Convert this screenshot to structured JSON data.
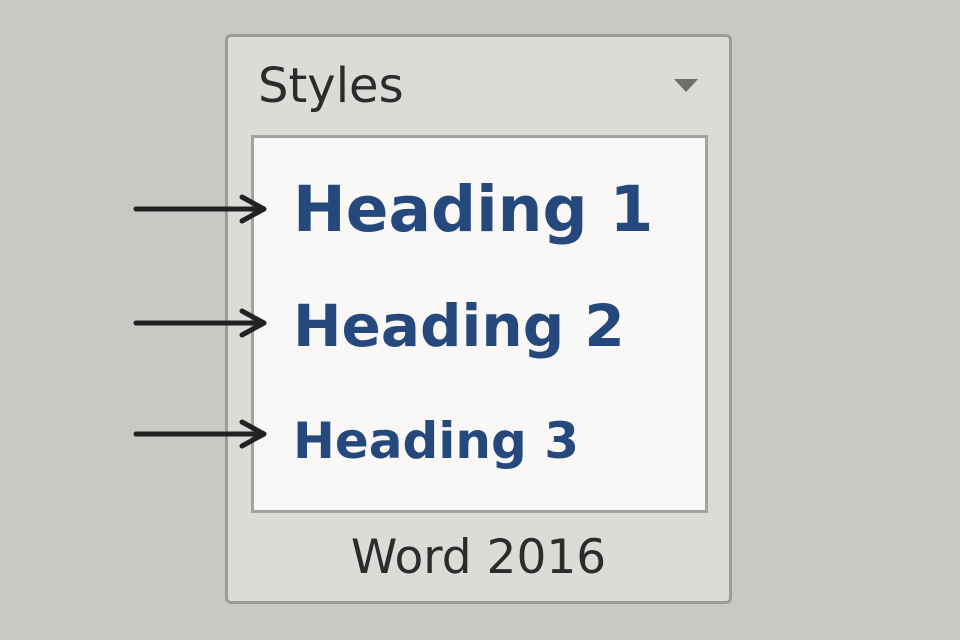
{
  "panel": {
    "title": "Styles",
    "dropdown_icon": "chevron-down-icon",
    "footer": "Word 2016"
  },
  "gallery": {
    "items": [
      {
        "label": "Heading 1"
      },
      {
        "label": "Heading 2"
      },
      {
        "label": "Heading 3"
      }
    ]
  },
  "annotations": {
    "arrow_icon": "arrow-right-icon"
  },
  "colors": {
    "background": "#c9c8c5",
    "panel_background": "#dcdbd8",
    "gallery_background": "#f9f8f6",
    "heading_text": "#25497c",
    "label_text": "#2c2c2c",
    "arrow": "#222222"
  }
}
